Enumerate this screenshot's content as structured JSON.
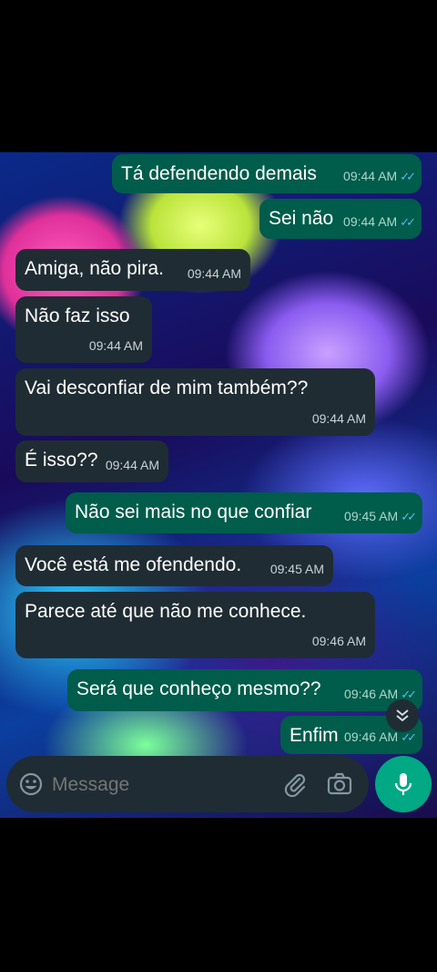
{
  "messages": [
    {
      "text": "Tá defendendo demais",
      "time": "09:44 AM",
      "dir": "out"
    },
    {
      "text": "Sei não",
      "time": "09:44 AM",
      "dir": "out"
    },
    {
      "text": "Amiga, não pira.",
      "time": "09:44 AM",
      "dir": "in"
    },
    {
      "text": "Não faz isso",
      "time": "09:44 AM",
      "dir": "in"
    },
    {
      "text": "Vai desconfiar de mim também??",
      "time": "09:44 AM",
      "dir": "in"
    },
    {
      "text": "É isso??",
      "time": "09:44 AM",
      "dir": "in"
    },
    {
      "text": "Não sei mais no que confiar",
      "time": "09:45 AM",
      "dir": "out"
    },
    {
      "text": "Você está me ofendendo.",
      "time": "09:45 AM",
      "dir": "in"
    },
    {
      "text": "Parece até que não me conhece.",
      "time": "09:46 AM",
      "dir": "in"
    },
    {
      "text": "Será que conheço mesmo??",
      "time": "09:46 AM",
      "dir": "out"
    },
    {
      "text": "Enfim",
      "time": "09:46 AM",
      "dir": "out"
    }
  ],
  "input": {
    "placeholder": "Message"
  },
  "colors": {
    "incoming": "#202c33",
    "outgoing": "#005c4b",
    "accent": "#00a884",
    "read_ticks": "#53bdeb"
  },
  "icons": {
    "emoji": "emoji-icon",
    "attach": "paperclip-icon",
    "camera": "camera-icon",
    "mic": "mic-icon",
    "scroll": "double-chevron-down-icon"
  }
}
